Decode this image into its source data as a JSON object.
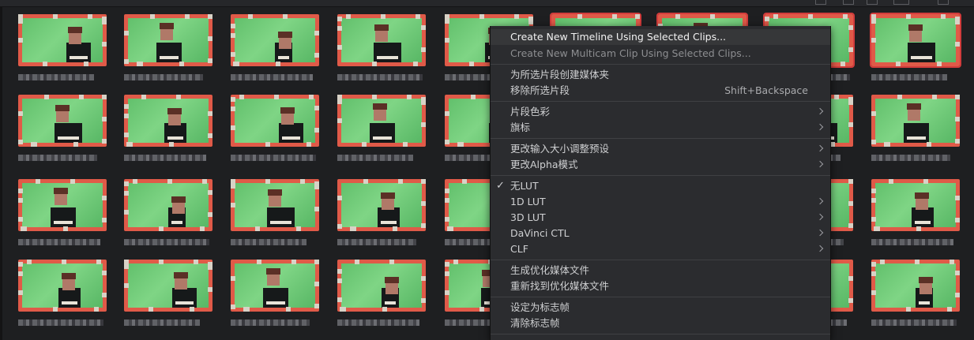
{
  "menu": {
    "items": [
      {
        "label": "Create New Timeline Using Selected Clips..."
      },
      {
        "label": "Create New Multicam Clip Using Selected Clips..."
      },
      {
        "label": "为所选片段创建媒体夹"
      },
      {
        "label": "移除所选片段",
        "shortcut": "Shift+Backspace"
      },
      {
        "label": "片段色彩"
      },
      {
        "label": "旗标"
      },
      {
        "label": "更改输入大小调整预设"
      },
      {
        "label": "更改Alpha模式"
      },
      {
        "label": "无LUT"
      },
      {
        "label": "1D LUT"
      },
      {
        "label": "3D LUT"
      },
      {
        "label": "DaVinci CTL"
      },
      {
        "label": "CLF"
      },
      {
        "label": "生成优化媒体文件"
      },
      {
        "label": "重新找到优化媒体文件"
      },
      {
        "label": "设定为标志帧"
      },
      {
        "label": "清除标志帧"
      }
    ]
  },
  "icons": {
    "checkmark": "✓"
  },
  "colors": {
    "accent_selected": "#d23c3c",
    "menu_bg": "#2b2c2f",
    "app_bg": "#1e1f21"
  }
}
